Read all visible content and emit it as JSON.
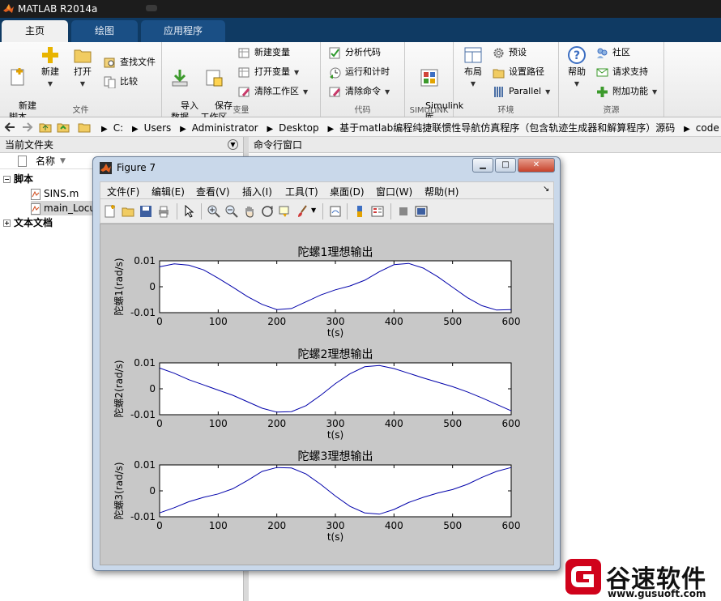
{
  "app": {
    "title": "MATLAB R2014a"
  },
  "tabs": [
    "主页",
    "绘图",
    "应用程序"
  ],
  "ribbon": {
    "file": {
      "label": "文件",
      "new_script": "新建\n脚本",
      "new": "新建",
      "open": "打开",
      "find_files": "查找文件",
      "compare": "比较"
    },
    "variable": {
      "label": "变量",
      "import": "导入\n数据",
      "save_workspace": "保存\n工作区",
      "new_variable": "新建变量",
      "open_variable": "打开变量",
      "clear_workspace": "清除工作区"
    },
    "code": {
      "label": "代码",
      "analyze": "分析代码",
      "run_time": "运行和计时",
      "clear_commands": "清除命令"
    },
    "simulink": {
      "label": "SIMULINK",
      "button": "Simulink\n库"
    },
    "environment": {
      "label": "环境",
      "layout": "布局",
      "preferences": "预设",
      "set_path": "设置路径",
      "parallel": "Parallel"
    },
    "resources": {
      "label": "资源",
      "help": "帮助",
      "community": "社区",
      "request_support": "请求支持",
      "addons": "附加功能"
    }
  },
  "address": {
    "crumbs": [
      "C:",
      "Users",
      "Administrator",
      "Desktop",
      "基于matlab编程纯捷联惯性导航仿真程序（包含轨迹生成器和解算程序）源码",
      "code"
    ]
  },
  "current_folder": {
    "title": "当前文件夹",
    "column": "名称",
    "group_scripts": "脚本",
    "files": [
      "SINS.m",
      "main_Locu"
    ],
    "group_docs": "文本文档"
  },
  "command_window": {
    "title": "命令行窗口"
  },
  "figure": {
    "title": "Figure 7",
    "menu": [
      "文件(F)",
      "编辑(E)",
      "查看(V)",
      "插入(I)",
      "工具(T)",
      "桌面(D)",
      "窗口(W)",
      "帮助(H)"
    ],
    "menu_arrow": "↘"
  },
  "chart_data": [
    {
      "type": "line",
      "title": "陀螺1理想输出",
      "xlabel": "t(s)",
      "ylabel": "陀螺1(rad/s)",
      "xlim": [
        0,
        600
      ],
      "ylim": [
        -0.01,
        0.01
      ],
      "xticks": [
        "0",
        "100",
        "200",
        "300",
        "400",
        "500",
        "600"
      ],
      "yticks": [
        "0.01",
        "0",
        "-0.01"
      ],
      "color": "#0000aa",
      "x": [
        0,
        25,
        50,
        75,
        100,
        125,
        150,
        175,
        200,
        225,
        250,
        275,
        300,
        325,
        350,
        375,
        400,
        425,
        450,
        475,
        500,
        525,
        550,
        575,
        600
      ],
      "y": [
        0.0077,
        0.0088,
        0.0083,
        0.0065,
        0.0033,
        -0.0002,
        -0.0038,
        -0.0068,
        -0.0088,
        -0.0084,
        -0.0058,
        -0.0032,
        -0.0012,
        0.0003,
        0.0025,
        0.0058,
        0.0085,
        0.009,
        0.0072,
        0.0038,
        -0.0002,
        -0.0042,
        -0.0073,
        -0.009,
        -0.0088
      ]
    },
    {
      "type": "line",
      "title": "陀螺2理想输出",
      "xlabel": "t(s)",
      "ylabel": "陀螺2(rad/s)",
      "xlim": [
        0,
        600
      ],
      "ylim": [
        -0.01,
        0.01
      ],
      "xticks": [
        "0",
        "100",
        "200",
        "300",
        "400",
        "500",
        "600"
      ],
      "yticks": [
        "0.01",
        "0",
        "-0.01"
      ],
      "color": "#0000aa",
      "x": [
        0,
        25,
        50,
        75,
        100,
        125,
        150,
        175,
        200,
        225,
        250,
        275,
        300,
        325,
        350,
        375,
        400,
        425,
        450,
        475,
        500,
        525,
        550,
        575,
        600
      ],
      "y": [
        0.008,
        0.006,
        0.0035,
        0.0015,
        -0.0005,
        -0.0025,
        -0.005,
        -0.0075,
        -0.009,
        -0.0088,
        -0.0065,
        -0.0025,
        0.002,
        0.0058,
        0.0085,
        0.009,
        0.0078,
        0.006,
        0.0042,
        0.0025,
        0.0008,
        -0.0012,
        -0.0035,
        -0.006,
        -0.0085
      ]
    },
    {
      "type": "line",
      "title": "陀螺3理想输出",
      "xlabel": "t(s)",
      "ylabel": "陀螺3(rad/s)",
      "xlim": [
        0,
        600
      ],
      "ylim": [
        -0.01,
        0.01
      ],
      "xticks": [
        "0",
        "100",
        "200",
        "300",
        "400",
        "500",
        "600"
      ],
      "yticks": [
        "0.01",
        "0",
        "-0.01"
      ],
      "color": "#0000aa",
      "x": [
        0,
        25,
        50,
        75,
        100,
        125,
        150,
        175,
        200,
        225,
        250,
        275,
        300,
        325,
        350,
        375,
        400,
        425,
        450,
        475,
        500,
        525,
        550,
        575,
        600
      ],
      "y": [
        -0.0085,
        -0.0065,
        -0.0042,
        -0.0025,
        -0.0012,
        0.0008,
        0.004,
        0.0075,
        0.009,
        0.0088,
        0.0065,
        0.0025,
        -0.002,
        -0.006,
        -0.0085,
        -0.009,
        -0.0072,
        -0.0045,
        -0.0025,
        -0.0008,
        0.0005,
        0.0025,
        0.0052,
        0.0075,
        0.009
      ]
    }
  ],
  "watermark": {
    "brand": "谷速软件",
    "url": "www.gusuoft.com",
    "color": "#d0021b"
  }
}
